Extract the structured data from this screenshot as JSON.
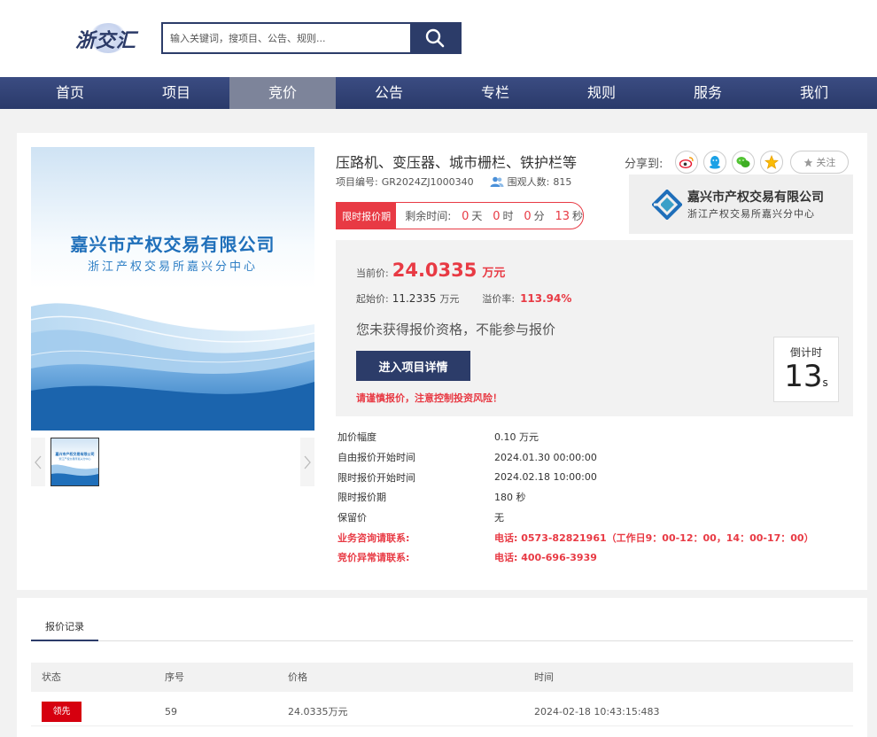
{
  "header": {
    "logo_text": "浙交汇",
    "search_placeholder": "输入关键词，搜项目、公告、规则..."
  },
  "nav": {
    "items": [
      "首页",
      "项目",
      "竞价",
      "公告",
      "专栏",
      "规则",
      "服务",
      "我们"
    ],
    "active_index": 2
  },
  "banner": {
    "line1": "嘉兴市产权交易有限公司",
    "line2": "浙江产权交易所嘉兴分中心"
  },
  "project": {
    "title": "压路机、变压器、城市栅栏、铁护栏等",
    "code_label": "项目编号:",
    "code": "GR2024ZJ1000340",
    "viewers_label": "围观人数:",
    "viewers": "815"
  },
  "share": {
    "label": "分享到:",
    "icons": [
      "weibo-icon",
      "qq-icon",
      "wechat-icon",
      "qzone-icon"
    ],
    "follow_label": "关注"
  },
  "org": {
    "name": "嘉兴市产权交易有限公司",
    "sub": "浙江产权交易所嘉兴分中心"
  },
  "timer": {
    "tag": "限时报价期",
    "remaining_label": "剩余时间:",
    "days": "0",
    "days_unit": "天",
    "hours": "0",
    "hours_unit": "时",
    "minutes": "0",
    "minutes_unit": "分",
    "seconds": "13",
    "seconds_unit": "秒"
  },
  "price": {
    "current_label": "当前价:",
    "current_value": "24.0335",
    "current_unit": "万元",
    "start_label": "起始价:",
    "start_value": "11.2335",
    "start_unit": "万元",
    "premium_label": "溢价率:",
    "premium_value": "113.94%",
    "no_qualification": "您未获得报价资格，不能参与报价",
    "enter_button": "进入项目详情",
    "warning": "请谨慎报价，注意控制投资风险！"
  },
  "countdown": {
    "label": "倒计时",
    "value": "13",
    "unit": "s"
  },
  "details": [
    {
      "key": "加价幅度",
      "value": "0.10 万元"
    },
    {
      "key": "自由报价开始时间",
      "value": "2024.01.30 00:00:00"
    },
    {
      "key": "限时报价开始时间",
      "value": "2024.02.18 10:00:00"
    },
    {
      "key": "限时报价期",
      "value": "180 秒"
    },
    {
      "key": "保留价",
      "value": "无"
    },
    {
      "key": "业务咨询请联系:",
      "value": "电话: 0573-82821961（工作日9：00-12：00，14：00-17：00）",
      "highlight": true
    },
    {
      "key": "竞价异常请联系:",
      "value": "电话: 400-696-3939",
      "highlight": true
    }
  ],
  "records": {
    "tab": "报价记录",
    "columns": [
      "状态",
      "序号",
      "价格",
      "时间"
    ],
    "rows": [
      {
        "status": "领先",
        "seq": "59",
        "price": "24.0335万元",
        "time": "2024-02-18 10:43:15:483"
      }
    ]
  },
  "colors": {
    "brand": "#2c3c69",
    "accent_red": "#e83a44",
    "badge_red": "#d6000f"
  }
}
